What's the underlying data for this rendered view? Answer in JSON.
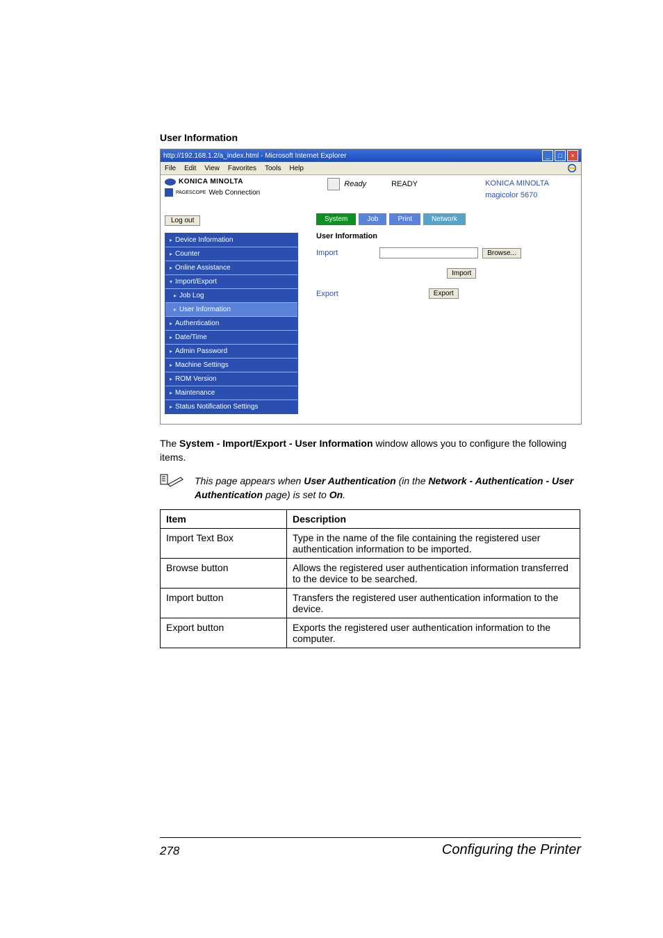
{
  "sectionHeading": "User Information",
  "screenshot": {
    "windowTitle": "http://192.168.1.2/a_index.html - Microsoft Internet Explorer",
    "menu": [
      "File",
      "Edit",
      "View",
      "Favorites",
      "Tools",
      "Help"
    ],
    "brand": {
      "line1": "KONICA MINOLTA",
      "line2_prefix": "PAGESCOPE",
      "line2_suffix": "Web Connection"
    },
    "statusMid": {
      "word": "Ready",
      "big": "READY"
    },
    "statusRight": {
      "l1": "KONICA MINOLTA",
      "l2": "magicolor 5670"
    },
    "logoutLabel": "Log out",
    "tabs": [
      "System",
      "Job",
      "Print",
      "Network"
    ],
    "nav": [
      "Device Information",
      "Counter",
      "Online Assistance",
      "Import/Export",
      "Job Log",
      "User Information",
      "Authentication",
      "Date/Time",
      "Admin Password",
      "Machine Settings",
      "ROM Version",
      "Maintenance",
      "Status Notification Settings"
    ],
    "navCarets": [
      "▸",
      "▸",
      "▸",
      "▾",
      "▸",
      "▸",
      "▸",
      "▸",
      "▸",
      "▸",
      "▸",
      "▸",
      "▸"
    ],
    "pane": {
      "title": "User Information",
      "importLabel": "Import",
      "browseLabel": "Browse...",
      "importBtn": "Import",
      "exportLabel": "Export",
      "exportBtn": "Export"
    }
  },
  "bodyPara": {
    "pre": "The ",
    "bold": "System - Import/Export - User Information",
    "post": " window allows you to configure the following items."
  },
  "note": {
    "pre": "This page appears when ",
    "b1": "User Authentication",
    "mid1": " (in the ",
    "b2": "Network - Authentication - User Authentication",
    "mid2": " page) is set to ",
    "b3": "On",
    "post": "."
  },
  "tableHeaders": {
    "item": "Item",
    "desc": "Description"
  },
  "tableRows": [
    {
      "item": "Import Text Box",
      "desc": "Type in the name of the file containing the registered user authentication information to be imported."
    },
    {
      "item": "Browse button",
      "desc": "Allows the registered user authentication information transferred to the device to be searched."
    },
    {
      "item": "Import button",
      "desc": "Transfers the registered user authentication information to the device."
    },
    {
      "item": "Export button",
      "desc": "Exports the registered user authentication information to the computer."
    }
  ],
  "footer": {
    "page": "278",
    "title": "Configuring the Printer"
  }
}
